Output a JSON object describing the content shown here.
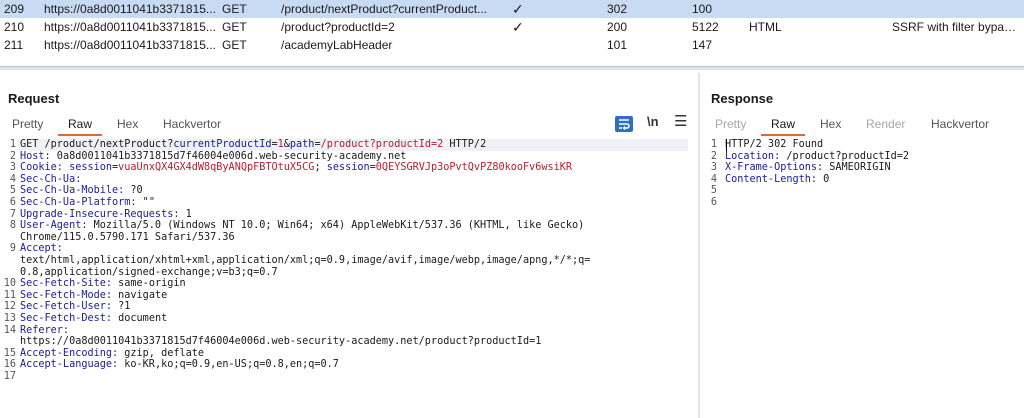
{
  "history": {
    "rows": [
      {
        "num": "209",
        "host": "https://0a8d0011041b3371815...",
        "method": "GET",
        "url": "/product/nextProduct?currentProduct...",
        "edited": "✓",
        "status": "302",
        "length": "100",
        "mime": "",
        "title": ""
      },
      {
        "num": "210",
        "host": "https://0a8d0011041b3371815...",
        "method": "GET",
        "url": "/product?productId=2",
        "edited": "✓",
        "status": "200",
        "length": "5122",
        "mime": "HTML",
        "title": "SSRF with filter bypass ..."
      },
      {
        "num": "211",
        "host": "https://0a8d0011041b3371815...",
        "method": "GET",
        "url": "/academyLabHeader",
        "edited": "",
        "status": "101",
        "length": "147",
        "mime": "",
        "title": ""
      }
    ]
  },
  "request": {
    "title": "Request",
    "tabs": [
      "Pretty",
      "Raw",
      "Hex",
      "Hackvertor"
    ],
    "active_tab": "Raw",
    "tools": {
      "newline_label": "\\n",
      "menu_label": "☰"
    },
    "lines": [
      {
        "n": "1",
        "parts": [
          [
            "",
            "GET /product/nextProduct?"
          ],
          [
            "k",
            "currentProductId"
          ],
          [
            "",
            "="
          ],
          [
            "red",
            "1"
          ],
          [
            "",
            "&"
          ],
          [
            "k",
            "path"
          ],
          [
            "",
            "="
          ],
          [
            "red",
            "/product?productId=2"
          ],
          [
            "",
            " HTTP/2"
          ]
        ]
      },
      {
        "n": "2",
        "parts": [
          [
            "k",
            "Host:"
          ],
          [
            "",
            " 0a8d0011041b3371815d7f46004e006d.web-security-academy.net"
          ]
        ]
      },
      {
        "n": "3",
        "parts": [
          [
            "k",
            "Cookie:"
          ],
          [
            "",
            " "
          ],
          [
            "k",
            "session"
          ],
          [
            "",
            "="
          ],
          [
            "red",
            "vuaUnxQX4GX4dW8qByANQpFBTOtuX5CG"
          ],
          [
            "",
            "; "
          ],
          [
            "k",
            "session"
          ],
          [
            "",
            "="
          ],
          [
            "red",
            "0QEYSGRVJp3oPvtQvPZ80kooFv6wsiKR"
          ]
        ]
      },
      {
        "n": "4",
        "parts": [
          [
            "k",
            "Sec-Ch-Ua:"
          ]
        ]
      },
      {
        "n": "5",
        "parts": [
          [
            "k",
            "Sec-Ch-Ua-Mobile:"
          ],
          [
            "",
            " ?0"
          ]
        ]
      },
      {
        "n": "6",
        "parts": [
          [
            "k",
            "Sec-Ch-Ua-Platform:"
          ],
          [
            "",
            " \"\""
          ]
        ]
      },
      {
        "n": "7",
        "parts": [
          [
            "k",
            "Upgrade-Insecure-Requests:"
          ],
          [
            "",
            " 1"
          ]
        ]
      },
      {
        "n": "8",
        "parts": [
          [
            "k",
            "User-Agent:"
          ],
          [
            "",
            " Mozilla/5.0 (Windows NT 10.0; Win64; x64) AppleWebKit/537.36 (KHTML, like Gecko)"
          ]
        ]
      },
      {
        "n": "",
        "parts": [
          [
            "",
            "Chrome/115.0.5790.171 Safari/537.36"
          ]
        ]
      },
      {
        "n": "9",
        "parts": [
          [
            "k",
            "Accept:"
          ]
        ]
      },
      {
        "n": "",
        "parts": [
          [
            "",
            "text/html,application/xhtml+xml,application/xml;q=0.9,image/avif,image/webp,image/apng,*/*;q="
          ]
        ]
      },
      {
        "n": "",
        "parts": [
          [
            "",
            "0.8,application/signed-exchange;v=b3;q=0.7"
          ]
        ]
      },
      {
        "n": "10",
        "parts": [
          [
            "k",
            "Sec-Fetch-Site:"
          ],
          [
            "",
            " same-origin"
          ]
        ]
      },
      {
        "n": "11",
        "parts": [
          [
            "k",
            "Sec-Fetch-Mode:"
          ],
          [
            "",
            " navigate"
          ]
        ]
      },
      {
        "n": "12",
        "parts": [
          [
            "k",
            "Sec-Fetch-User:"
          ],
          [
            "",
            " ?1"
          ]
        ]
      },
      {
        "n": "13",
        "parts": [
          [
            "k",
            "Sec-Fetch-Dest:"
          ],
          [
            "",
            " document"
          ]
        ]
      },
      {
        "n": "14",
        "parts": [
          [
            "k",
            "Referer:"
          ]
        ]
      },
      {
        "n": "",
        "parts": [
          [
            "",
            "https://0a8d0011041b3371815d7f46004e006d.web-security-academy.net/product?productId=1"
          ]
        ]
      },
      {
        "n": "15",
        "parts": [
          [
            "k",
            "Accept-Encoding:"
          ],
          [
            "",
            " gzip, deflate"
          ]
        ]
      },
      {
        "n": "16",
        "parts": [
          [
            "k",
            "Accept-Language:"
          ],
          [
            "",
            " ko-KR,ko;q=0.9,en-US;q=0.8,en;q=0.7"
          ]
        ]
      },
      {
        "n": "17",
        "parts": []
      }
    ]
  },
  "response": {
    "title": "Response",
    "tabs": [
      "Pretty",
      "Raw",
      "Hex",
      "Render",
      "Hackvertor"
    ],
    "active_tab": "Raw",
    "disabled_tabs": [
      "Pretty",
      "Render"
    ],
    "lines": [
      {
        "n": "1",
        "parts": [
          [
            "",
            "HTTP/2 302 Found"
          ]
        ]
      },
      {
        "n": "2",
        "parts": [
          [
            "k",
            "Location:"
          ],
          [
            "",
            " /product?productId=2"
          ]
        ]
      },
      {
        "n": "3",
        "parts": [
          [
            "k",
            "X-Frame-Options:"
          ],
          [
            "",
            " SAMEORIGIN"
          ]
        ]
      },
      {
        "n": "4",
        "parts": [
          [
            "k",
            "Content-Length:"
          ],
          [
            "",
            " 0"
          ]
        ]
      },
      {
        "n": "5",
        "parts": []
      },
      {
        "n": "6",
        "parts": []
      }
    ]
  },
  "colors": {
    "selected_row": "#c9daf3",
    "accent_underline": "#e2692a",
    "keyword": "#1b1b98",
    "value_red": "#b5202e",
    "wrap_button": "#2d6fc1"
  }
}
